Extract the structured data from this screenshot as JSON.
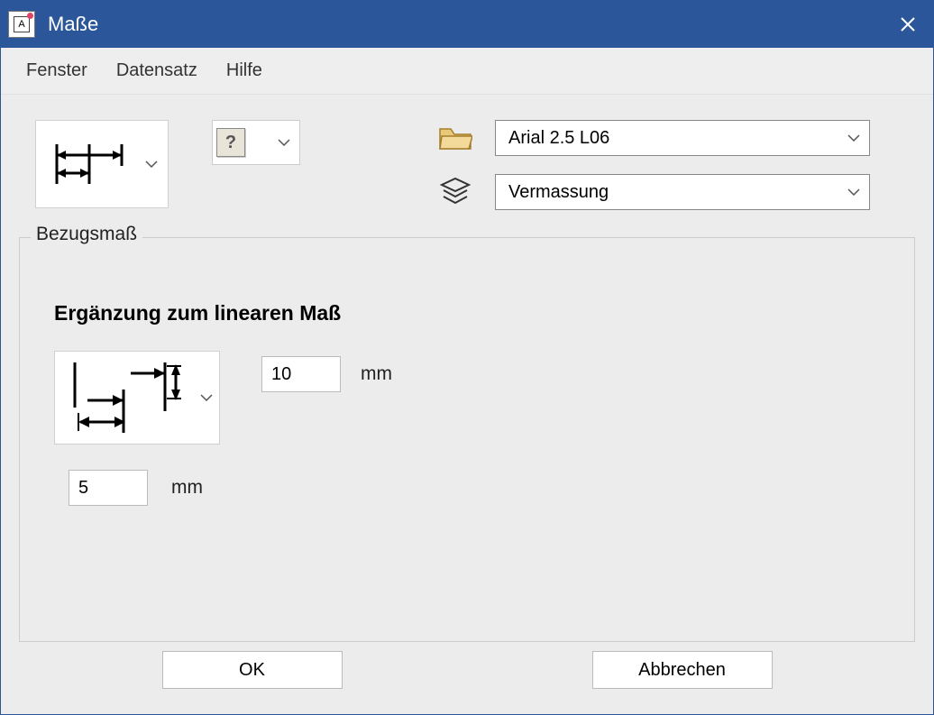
{
  "window": {
    "title": "Maße"
  },
  "menu": {
    "fenster": "Fenster",
    "datensatz": "Datensatz",
    "hilfe": "Hilfe"
  },
  "toolbar": {
    "font_style": "Arial 2.5 L06",
    "layer": "Vermassung"
  },
  "groupbox": {
    "label": "Bezugsmaß",
    "heading": "Ergänzung zum linearen Maß",
    "value1": "10",
    "unit1": "mm",
    "value2": "5",
    "unit2": "mm"
  },
  "buttons": {
    "ok": "OK",
    "cancel": "Abbrechen"
  }
}
